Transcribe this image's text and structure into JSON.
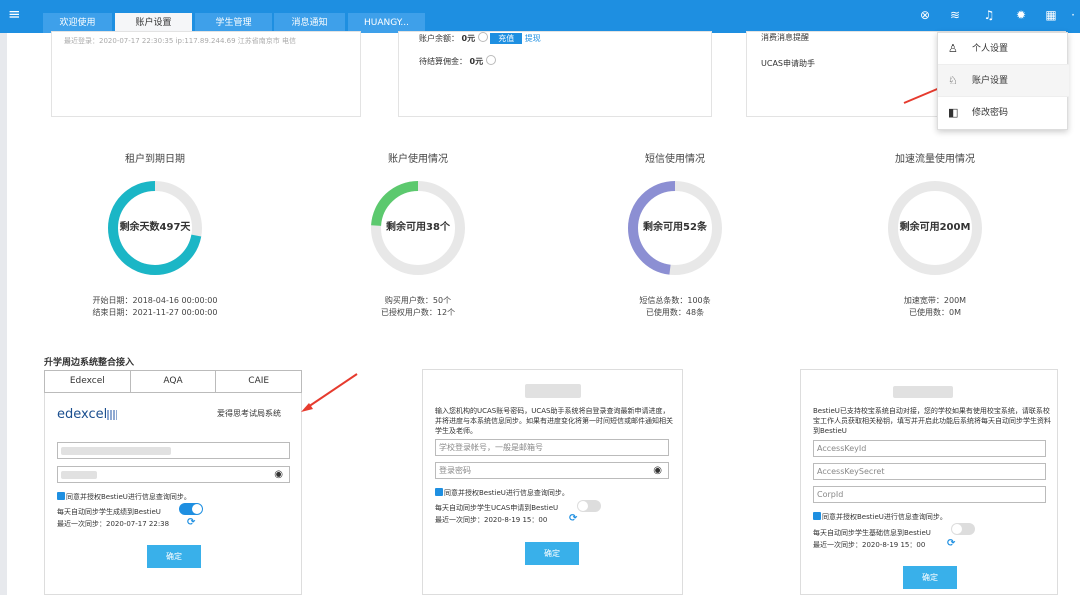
{
  "tabs": [
    {
      "label": "欢迎使用"
    },
    {
      "label": "账户设置"
    },
    {
      "label": "学生管理"
    },
    {
      "label": "消息通知"
    },
    {
      "label": "HUANGY..."
    }
  ],
  "top_cards": {
    "last_login": "最近登录：2020-07-17 22:30:35 ip:117.89.244.69 江苏省南京市 电信",
    "balance_label": "账户余额：",
    "balance_value": "0元",
    "recharge": "充值",
    "withdraw": "提现",
    "pending_label": "待结算佣金：",
    "pending_value": "0元",
    "reminder1": "消费消息提醒",
    "reminder2": "UCAS申请助手"
  },
  "donuts": [
    {
      "title": "租户到期日期",
      "label": "剩余天数497天",
      "info1": "开始日期：2018-04-16 00:00:00",
      "info2": "结束日期：2021-11-27 00:00:00",
      "color": "#1bb6c6",
      "percent": 0.72
    },
    {
      "title": "账户使用情况",
      "label": "剩余可用38个",
      "info1": "购买用户数：50个",
      "info2": "已授权用户数：12个",
      "color": "#5cc96e",
      "percent": 0.24
    },
    {
      "title": "短信使用情况",
      "label": "剩余可用52条",
      "info1": "短信总条数：100条",
      "info2": "已使用数：48条",
      "color": "#8c8fd3",
      "percent": 0.48
    },
    {
      "title": "加速流量使用情况",
      "label": "剩余可用200M",
      "info1": "加速宽带：200M",
      "info2": "已使用数：0M",
      "color": "#e5e5e5",
      "percent": 0
    }
  ],
  "section_title": "升学周边系统整合接入",
  "subtabs": [
    "Edexcel",
    "AQA",
    "CAIE"
  ],
  "edexcel": {
    "brand": "edexcel",
    "subtitle": "爱得思考试局系统",
    "auth": "同意并授权BestieU进行信息查询同步。",
    "auto_sync": "每天自动同步学生成绩到BestieU",
    "last_sync": "最近一次同步：2020-07-17 22:38",
    "confirm": "确定"
  },
  "ucas": {
    "desc": "输入您机构的UCAS账号密码，UCAS助手系统将自登录查询最新申请进度，并将进度与本系统信息同步。如果有进度变化将第一时间短信或邮件通知相关学生及老师。",
    "user_placeholder": "学校登录帐号，一般是邮箱号",
    "pwd_placeholder": "登录密码",
    "auth": "同意并授权BestieU进行信息查询同步。",
    "auto_sync": "每天自动同步学生UCAS申请到BestieU",
    "last_sync": "最近一次同步：2020-8-19 15：00",
    "confirm": "确定"
  },
  "bestie": {
    "desc": "BestieU已支持校宝系统自动对接，您的学校如果有使用校宝系统，请联系校宝工作人员获取相关秘钥，填写并开启此功能后系统将每天自动同步学生资料到BestieU",
    "f1": "AccessKeyId",
    "f2": "AccessKeySecret",
    "f3": "CorpId",
    "auth": "同意并授权BestieU进行信息查询同步。",
    "auto_sync": "每天自动同步学生基础信息到BestieU",
    "last_sync": "最近一次同步：2020-8-19 15：00",
    "confirm": "确定"
  },
  "dropdown": [
    {
      "icon": "user-icon",
      "label": "个人设置"
    },
    {
      "icon": "user-gear-icon",
      "label": "账户设置"
    },
    {
      "icon": "wallet-icon",
      "label": "修改密码"
    }
  ]
}
